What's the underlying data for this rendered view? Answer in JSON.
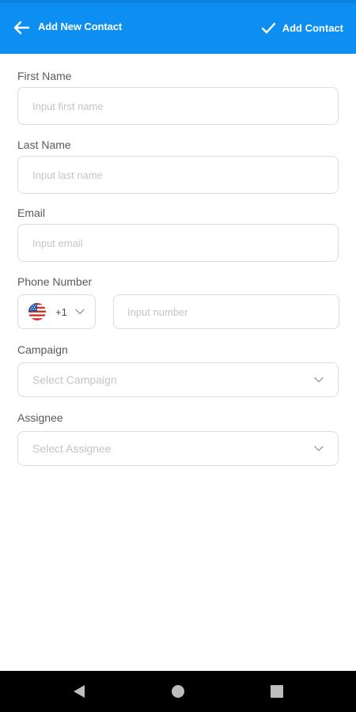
{
  "header": {
    "title": "Add New Contact",
    "action_label": "Add Contact",
    "back_icon": "arrow-left-icon",
    "action_icon": "checkmark-icon",
    "color": "#0d8ff2"
  },
  "form": {
    "first_name": {
      "label": "First Name",
      "placeholder": "Input first name",
      "value": ""
    },
    "last_name": {
      "label": "Last Name",
      "placeholder": "Input last name",
      "value": ""
    },
    "email": {
      "label": "Email",
      "placeholder": "Input email",
      "value": ""
    },
    "phone": {
      "label": "Phone Number",
      "country_flag": "us-flag-icon",
      "country_code": "+1",
      "placeholder": "Input number",
      "value": ""
    },
    "campaign": {
      "label": "Campaign",
      "placeholder": "Select Campaign"
    },
    "assignee": {
      "label": "Assignee",
      "placeholder": "Select Assignee"
    }
  },
  "system_nav": {
    "icons": [
      "back-triangle-icon",
      "home-circle-icon",
      "recents-square-icon"
    ]
  }
}
